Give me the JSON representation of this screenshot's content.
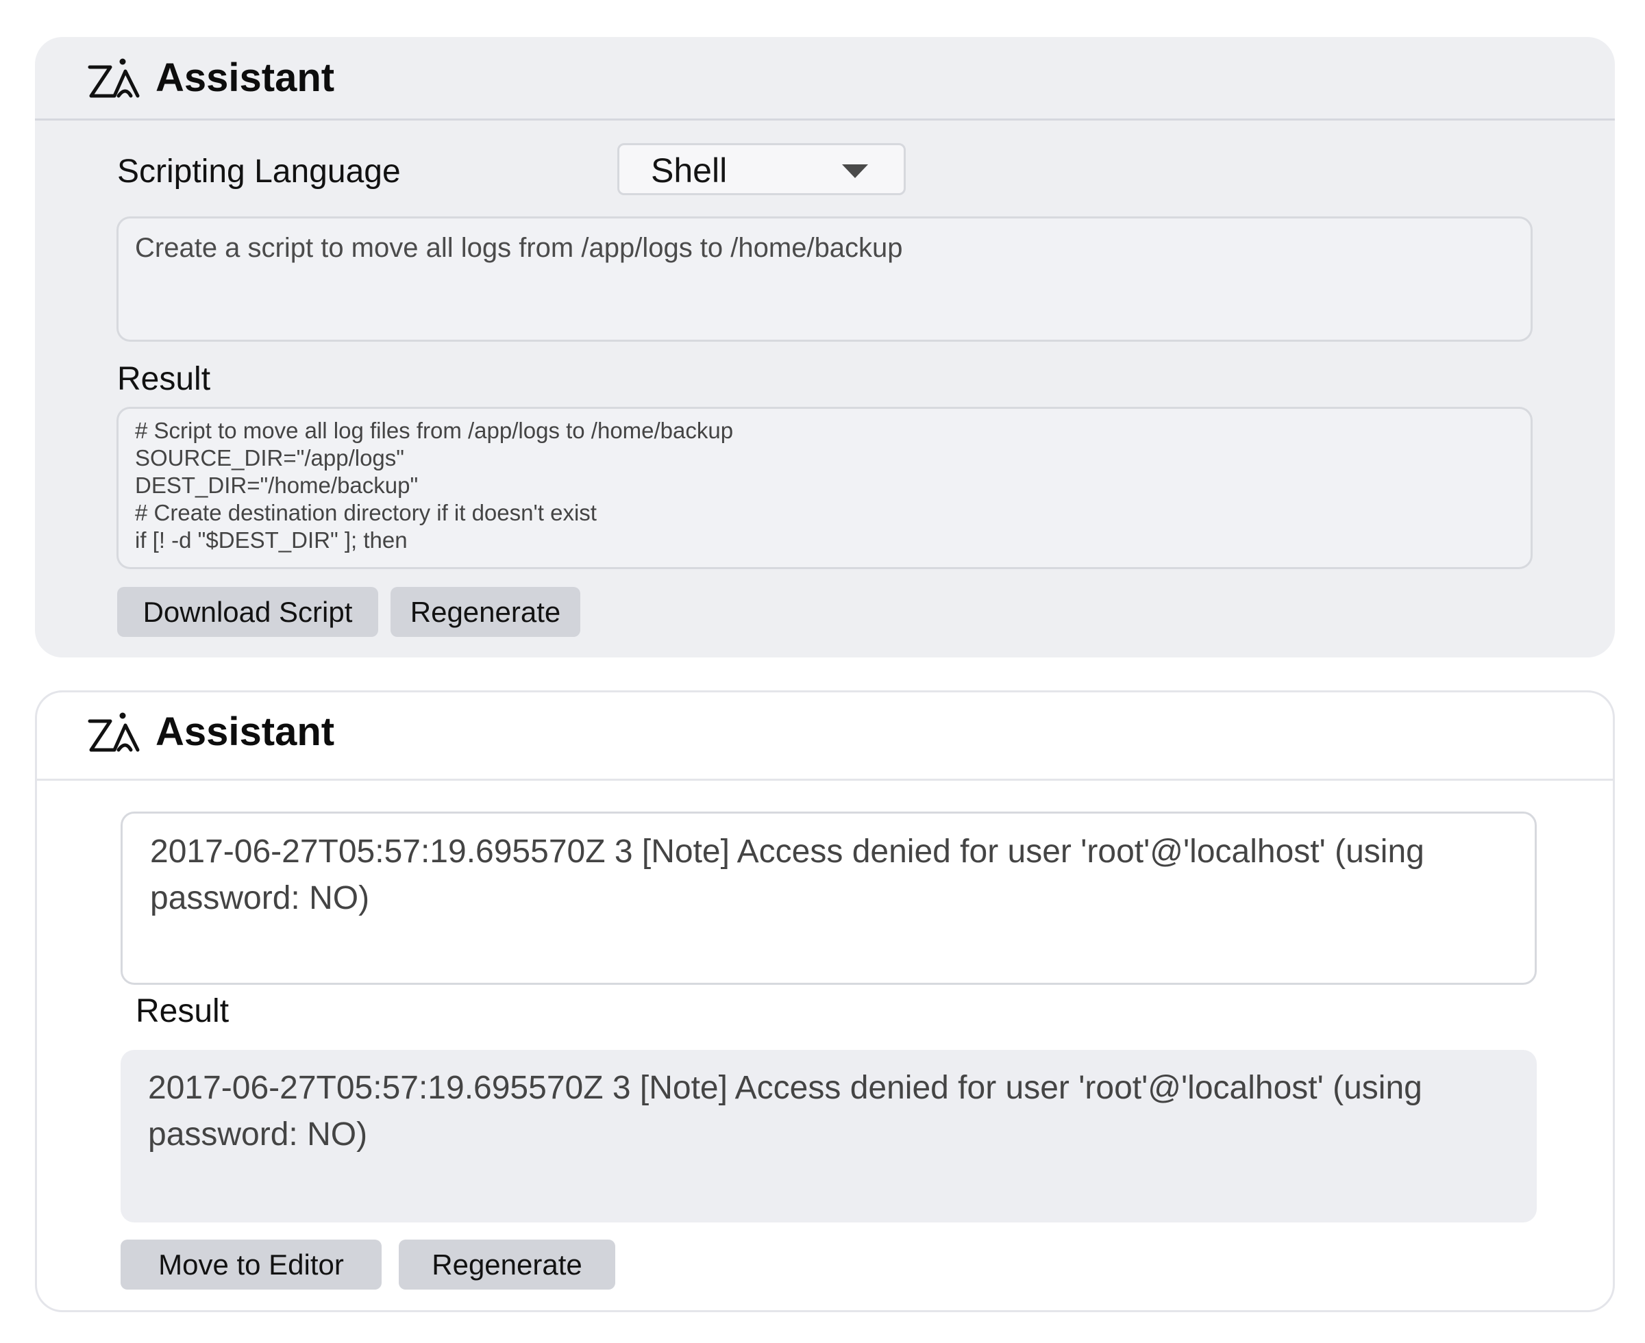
{
  "panel1": {
    "header_title": "Assistant",
    "scripting_language_label": "Scripting Language",
    "language_select_value": "Shell",
    "prompt_text": "Create a script to move all logs from /app/logs to /home/backup",
    "result_label": "Result",
    "result_lines": [
      "# Script to move all log files from /app/logs to /home/backup",
      "SOURCE_DIR=\"/app/logs\"",
      "DEST_DIR=\"/home/backup\"",
      "# Create destination directory if it doesn't exist",
      "if [! -d \"$DEST_DIR\" ]; then"
    ],
    "download_button_label": "Download Script",
    "regenerate_button_label": "Regenerate"
  },
  "panel2": {
    "header_title": "Assistant",
    "prompt_text": "2017-06-27T05:57:19.695570Z 3 [Note] Access denied for user 'root'@'localhost' (using password: NO)",
    "result_label": "Result",
    "result_text": "2017-06-27T05:57:19.695570Z 3 [Note] Access denied for user 'root'@'localhost' (using password: NO)",
    "move_button_label": "Move to Editor",
    "regenerate_button_label": "Regenerate"
  },
  "icons": {
    "logo": "assistant-logo-icon",
    "dropdown": "chevron-down-icon"
  },
  "colors": {
    "panel_background": "#eeeff2",
    "button_background": "#d2d4da",
    "result_background": "#edeef2"
  }
}
